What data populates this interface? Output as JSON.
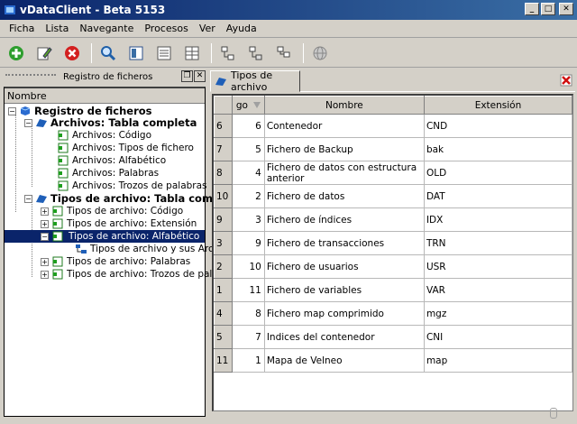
{
  "window": {
    "title": "vDataClient - Beta 5153"
  },
  "menu": [
    "Ficha",
    "Lista",
    "Navegante",
    "Procesos",
    "Ver",
    "Ayuda"
  ],
  "left_panel": {
    "title": "Registro de ficheros",
    "tree_header": "Nombre",
    "tree": [
      {
        "label": "Registro de ficheros"
      },
      {
        "label": "Archivos: Tabla completa"
      },
      {
        "label": "Archivos: Código"
      },
      {
        "label": "Archivos: Tipos de fichero"
      },
      {
        "label": "Archivos: Alfabético"
      },
      {
        "label": "Archivos: Palabras"
      },
      {
        "label": "Archivos: Trozos de palabras"
      },
      {
        "label": "Tipos de archivo: Tabla compl..."
      },
      {
        "label": "Tipos de archivo: Código"
      },
      {
        "label": "Tipos de archivo: Extensión"
      },
      {
        "label": "Tipos de archivo: Alfabético"
      },
      {
        "label": "Tipos de archivo y sus Archi..."
      },
      {
        "label": "Tipos de archivo: Palabras"
      },
      {
        "label": "Tipos de archivo: Trozos de pala..."
      }
    ]
  },
  "tab": {
    "label": "Tipos de archivo"
  },
  "grid": {
    "columns": [
      "",
      "go",
      "Nombre",
      "Extensión"
    ],
    "rows": [
      {
        "row": "6",
        "go": "6",
        "nombre": "Contenedor",
        "ext": "CND"
      },
      {
        "row": "7",
        "go": "5",
        "nombre": "Fichero de Backup",
        "ext": "bak"
      },
      {
        "row": "8",
        "go": "4",
        "nombre": "Fichero de datos con estructura anterior",
        "ext": "OLD"
      },
      {
        "row": "10",
        "go": "2",
        "nombre": "Fichero de datos",
        "ext": "DAT"
      },
      {
        "row": "9",
        "go": "3",
        "nombre": "Fichero de índices",
        "ext": "IDX"
      },
      {
        "row": "3",
        "go": "9",
        "nombre": "Fichero de transacciones",
        "ext": "TRN"
      },
      {
        "row": "2",
        "go": "10",
        "nombre": "Fichero de usuarios",
        "ext": "USR"
      },
      {
        "row": "1",
        "go": "11",
        "nombre": "Fichero de variables",
        "ext": "VAR"
      },
      {
        "row": "4",
        "go": "8",
        "nombre": "Fichero map comprimido",
        "ext": "mgz"
      },
      {
        "row": "5",
        "go": "7",
        "nombre": "Indices del contenedor",
        "ext": "CNI"
      },
      {
        "row": "11",
        "go": "1",
        "nombre": "Mapa de Velneo",
        "ext": "map"
      }
    ]
  }
}
